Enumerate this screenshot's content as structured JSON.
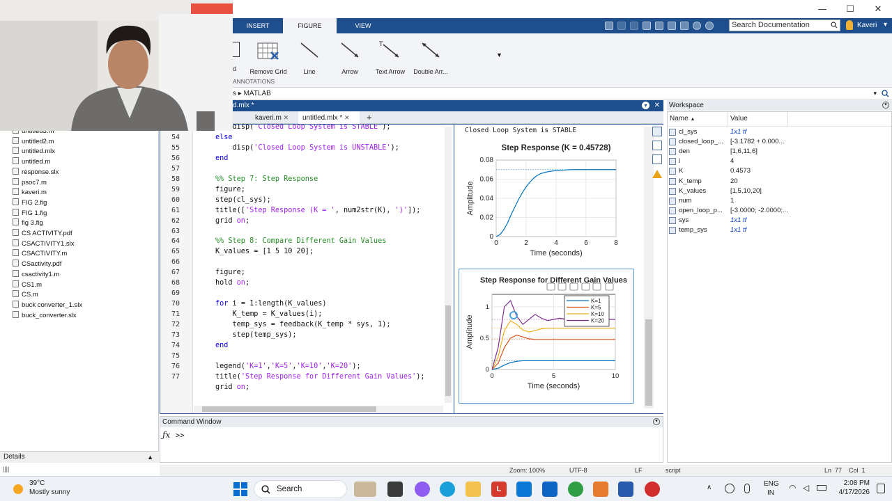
{
  "ribbon": {
    "tabs": [
      "INSERT",
      "FIGURE",
      "VIEW"
    ],
    "active_tab": "FIGURE",
    "search_placeholder": "Search Documentation",
    "user": "Kaveri",
    "buttons": [
      "Remove Grid",
      "Line",
      "Arrow",
      "Text Arrow",
      "Double Arr..."
    ],
    "group_label": "ANNOTATIONS",
    "address": "MATLAB"
  },
  "editor": {
    "doc_title": "d.mlx *",
    "tabs": [
      "kaveri.m",
      "untitled.mlx *"
    ],
    "active_tab": "untitled.mlx *",
    "lines": [
      {
        "n": "53",
        "indent": "    ",
        "parts": [
          {
            "t": "disp(",
            "c": ""
          },
          {
            "t": "'Closed Loop System is STABLE'",
            "c": "str"
          },
          {
            "t": ");",
            "c": ""
          }
        ]
      },
      {
        "n": "54",
        "indent": "",
        "parts": [
          {
            "t": "else",
            "c": "kw"
          }
        ]
      },
      {
        "n": "55",
        "indent": "    ",
        "parts": [
          {
            "t": "disp(",
            "c": ""
          },
          {
            "t": "'Closed Loop System is UNSTABLE'",
            "c": "str"
          },
          {
            "t": ");",
            "c": ""
          }
        ]
      },
      {
        "n": "56",
        "indent": "",
        "parts": [
          {
            "t": "end",
            "c": "kw"
          }
        ]
      },
      {
        "n": "57",
        "indent": "",
        "parts": []
      },
      {
        "n": "58",
        "indent": "",
        "parts": [
          {
            "t": "%% Step 7: Step Response",
            "c": "com"
          }
        ]
      },
      {
        "n": "59",
        "indent": "",
        "parts": [
          {
            "t": "figure;",
            "c": ""
          }
        ]
      },
      {
        "n": "60",
        "indent": "",
        "parts": [
          {
            "t": "step(cl_sys);",
            "c": ""
          }
        ]
      },
      {
        "n": "61",
        "indent": "",
        "parts": [
          {
            "t": "title([",
            "c": ""
          },
          {
            "t": "'Step Response (K = '",
            "c": "str"
          },
          {
            "t": ", num2str(K), ",
            "c": ""
          },
          {
            "t": "')'",
            "c": "str"
          },
          {
            "t": "]);",
            "c": ""
          }
        ]
      },
      {
        "n": "62",
        "indent": "",
        "parts": [
          {
            "t": "grid ",
            "c": ""
          },
          {
            "t": "on",
            "c": "str"
          },
          {
            "t": ";",
            "c": ""
          }
        ]
      },
      {
        "n": "63",
        "indent": "",
        "parts": []
      },
      {
        "n": "64",
        "indent": "",
        "parts": [
          {
            "t": "%% Step 8: Compare Different Gain Values",
            "c": "com"
          }
        ]
      },
      {
        "n": "65",
        "indent": "",
        "parts": [
          {
            "t": "K_values = [1 5 10 20];",
            "c": ""
          }
        ]
      },
      {
        "n": "66",
        "indent": "",
        "parts": []
      },
      {
        "n": "67",
        "indent": "",
        "parts": [
          {
            "t": "figure;",
            "c": ""
          }
        ]
      },
      {
        "n": "68",
        "indent": "",
        "parts": [
          {
            "t": "hold ",
            "c": ""
          },
          {
            "t": "on",
            "c": "str"
          },
          {
            "t": ";",
            "c": ""
          }
        ]
      },
      {
        "n": "69",
        "indent": "",
        "parts": []
      },
      {
        "n": "70",
        "indent": "",
        "parts": [
          {
            "t": "for ",
            "c": "kw"
          },
          {
            "t": "i = 1:length(K_values)",
            "c": ""
          }
        ]
      },
      {
        "n": "71",
        "indent": "    ",
        "parts": [
          {
            "t": "K_temp = K_values(i);",
            "c": ""
          }
        ]
      },
      {
        "n": "72",
        "indent": "    ",
        "parts": [
          {
            "t": "temp_sys = feedback(K_temp * sys, 1);",
            "c": ""
          }
        ]
      },
      {
        "n": "73",
        "indent": "    ",
        "parts": [
          {
            "t": "step(temp_sys);",
            "c": ""
          }
        ]
      },
      {
        "n": "74",
        "indent": "",
        "parts": [
          {
            "t": "end",
            "c": "kw"
          }
        ]
      },
      {
        "n": "75",
        "indent": "",
        "parts": []
      },
      {
        "n": "76",
        "indent": "",
        "parts": [
          {
            "t": "legend(",
            "c": ""
          },
          {
            "t": "'K=1'",
            "c": "str"
          },
          {
            "t": ",",
            "c": ""
          },
          {
            "t": "'K=5'",
            "c": "str"
          },
          {
            "t": ",",
            "c": ""
          },
          {
            "t": "'K=10'",
            "c": "str"
          },
          {
            "t": ",",
            "c": ""
          },
          {
            "t": "'K=20'",
            "c": "str"
          },
          {
            "t": ");",
            "c": ""
          }
        ]
      },
      {
        "n": "77",
        "indent": "",
        "parts": [
          {
            "t": "title(",
            "c": ""
          },
          {
            "t": "'Step Response for Different Gain Values'",
            "c": "str"
          },
          {
            "t": ");",
            "c": ""
          }
        ]
      },
      {
        "n": "",
        "indent": "",
        "parts": [
          {
            "t": "grid ",
            "c": ""
          },
          {
            "t": "on",
            "c": "str"
          },
          {
            "t": ";",
            "c": ""
          }
        ]
      }
    ]
  },
  "files": [
    "untitled3.m",
    "untitled2.m",
    "untitled.mlx",
    "untitled.m",
    "response.slx",
    "psoc7.m",
    "kaveri.m",
    "FIG 2.fig",
    "FIG 1.fig",
    "fig 3.fig",
    "CS ACTIVITY.pdf",
    "CSACTIVITY1.slx",
    "CSACTIVITY.m",
    "CSactivity.pdf",
    "csactivity1.m",
    "CS1.m",
    "CS.m",
    "buck converter_1.slx",
    "buck_converter.slx"
  ],
  "output": {
    "message": "Closed Loop System is STABLE"
  },
  "chart_data": [
    {
      "type": "line",
      "title": "Step Response (K = 0.45728)",
      "xlabel": "Time (seconds)",
      "ylabel": "Amplitude",
      "xlim": [
        0,
        8
      ],
      "ylim": [
        0,
        0.08
      ],
      "xticks": [
        "0",
        "2",
        "4",
        "6",
        "8"
      ],
      "yticks": [
        "0",
        "0.02",
        "0.04",
        "0.06",
        "0.08"
      ],
      "grid": true,
      "series": [
        {
          "color": "#0072bd",
          "x": [
            0,
            0.25,
            0.5,
            0.75,
            1,
            1.25,
            1.5,
            1.75,
            2,
            2.25,
            2.5,
            2.75,
            3,
            3.5,
            4,
            4.5,
            5,
            6,
            7,
            8
          ],
          "y": [
            0,
            0.002,
            0.007,
            0.014,
            0.023,
            0.031,
            0.039,
            0.046,
            0.052,
            0.057,
            0.061,
            0.064,
            0.066,
            0.068,
            0.069,
            0.0695,
            0.07,
            0.07,
            0.07,
            0.07
          ]
        }
      ]
    },
    {
      "type": "line",
      "title": "Step Response for Different Gain Values",
      "xlabel": "Time (seconds)",
      "ylabel": "Amplitude",
      "xlim": [
        0,
        10
      ],
      "ylim": [
        0,
        1.2
      ],
      "xticks": [
        "0",
        "5",
        "10"
      ],
      "yticks": [
        "0",
        "0.5",
        "1"
      ],
      "grid": true,
      "legend": "top-right",
      "series": [
        {
          "name": "K=1",
          "color": "#0072bd",
          "x": [
            0,
            0.5,
            1,
            1.5,
            2,
            2.5,
            3,
            4,
            5,
            6,
            8,
            10
          ],
          "y": [
            0,
            0.02,
            0.07,
            0.11,
            0.13,
            0.14,
            0.14,
            0.14,
            0.14,
            0.14,
            0.14,
            0.14
          ]
        },
        {
          "name": "K=5",
          "color": "#d95319",
          "x": [
            0,
            0.5,
            1,
            1.5,
            2,
            2.5,
            3,
            3.5,
            4,
            5,
            6,
            8,
            10
          ],
          "y": [
            0,
            0.1,
            0.35,
            0.5,
            0.55,
            0.52,
            0.49,
            0.48,
            0.48,
            0.48,
            0.48,
            0.48,
            0.48
          ]
        },
        {
          "name": "K=10",
          "color": "#edb120",
          "x": [
            0,
            0.5,
            1,
            1.5,
            2,
            2.5,
            3,
            3.5,
            4,
            4.5,
            5,
            6,
            8,
            10
          ],
          "y": [
            0,
            0.2,
            0.62,
            0.78,
            0.72,
            0.63,
            0.6,
            0.62,
            0.65,
            0.66,
            0.66,
            0.66,
            0.66,
            0.66
          ]
        },
        {
          "name": "K=20",
          "color": "#7e2f8e",
          "x": [
            0,
            0.5,
            1,
            1.5,
            2,
            2.5,
            3,
            3.5,
            4,
            4.5,
            5,
            5.5,
            6,
            7,
            8,
            10
          ],
          "y": [
            0,
            0.35,
            1.0,
            1.1,
            0.85,
            0.72,
            0.8,
            0.88,
            0.82,
            0.78,
            0.8,
            0.82,
            0.8,
            0.8,
            0.8,
            0.8
          ]
        }
      ]
    }
  ],
  "workspace": {
    "title": "Workspace",
    "col_name": "Name",
    "col_value": "Value",
    "vars": [
      {
        "name": "cl_sys",
        "value": "1x1 tf",
        "it": true
      },
      {
        "name": "closed_loop_...",
        "value": "[-3.1782 + 0.000...",
        "it": false
      },
      {
        "name": "den",
        "value": "[1,6,11,6]",
        "it": false
      },
      {
        "name": "i",
        "value": "4",
        "it": false
      },
      {
        "name": "K",
        "value": "0.4573",
        "it": false
      },
      {
        "name": "K_temp",
        "value": "20",
        "it": false
      },
      {
        "name": "K_values",
        "value": "[1,5,10,20]",
        "it": false
      },
      {
        "name": "num",
        "value": "1",
        "it": false
      },
      {
        "name": "open_loop_p...",
        "value": "[-3.0000; -2.0000;...",
        "it": false
      },
      {
        "name": "sys",
        "value": "1x1 tf",
        "it": true
      },
      {
        "name": "temp_sys",
        "value": "1x1 tf",
        "it": true
      }
    ]
  },
  "command": {
    "title": "Command Window",
    "prompt": ">>"
  },
  "details_label": "Details",
  "status": {
    "zoom": "Zoom: 100%",
    "encoding": "UTF-8",
    "eol": "LF",
    "mode": "script",
    "position": "Ln  77    Col  1"
  },
  "taskbar": {
    "weather_temp": "39°C",
    "weather_desc": "Mostly sunny",
    "search_label": "Search",
    "lang": "ENG",
    "region": "IN",
    "time": "2:08 PM",
    "date": "4/17/2026"
  }
}
